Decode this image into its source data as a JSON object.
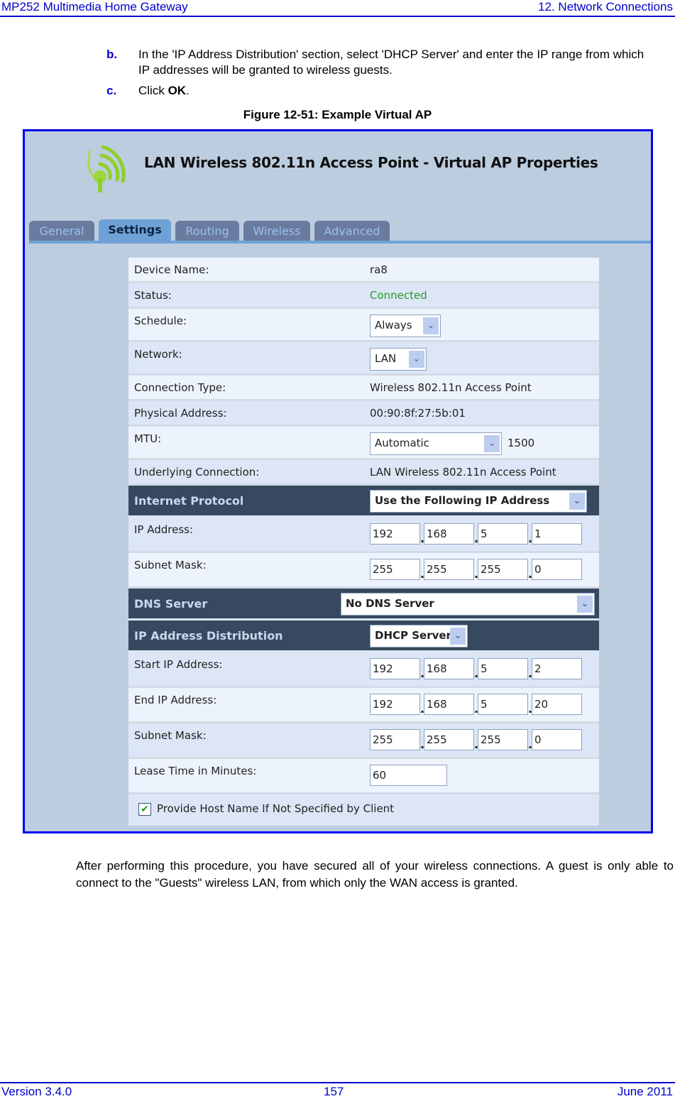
{
  "header": {
    "left": "MP252 Multimedia Home Gateway",
    "right": "12. Network Connections"
  },
  "steps": [
    {
      "letter": "b.",
      "text": "In the 'IP Address Distribution' section, select 'DHCP Server' and enter the IP range from which IP addresses will be granted to wireless guests."
    },
    {
      "letter": "c.",
      "text_before": "Click ",
      "bold": "OK",
      "text_after": "."
    }
  ],
  "figure": {
    "caption": "Figure 12-51: Example Virtual AP",
    "screen": {
      "title": "LAN Wireless 802.11n Access Point - Virtual AP Properties",
      "logo_icon": "wireless-signal-icon",
      "tabs": [
        {
          "label": "General",
          "active": false
        },
        {
          "label": "Settings",
          "active": true
        },
        {
          "label": "Routing",
          "active": false
        },
        {
          "label": "Wireless",
          "active": false
        },
        {
          "label": "Advanced",
          "active": false
        }
      ],
      "fields": {
        "device_name": {
          "label": "Device Name:",
          "value": "ra8"
        },
        "status": {
          "label": "Status:",
          "value": "Connected",
          "color": "#2a9a2a"
        },
        "schedule": {
          "label": "Schedule:",
          "selected": "Always"
        },
        "network": {
          "label": "Network:",
          "selected": "LAN"
        },
        "connection_type": {
          "label": "Connection Type:",
          "value": "Wireless 802.11n Access Point"
        },
        "physical_address": {
          "label": "Physical Address:",
          "value": "00:90:8f:27:5b:01"
        },
        "mtu": {
          "label": "MTU:",
          "selected": "Automatic",
          "value": "1500"
        },
        "underlying_connection": {
          "label": "Underlying Connection:",
          "value": "LAN Wireless 802.11n Access Point"
        }
      },
      "internet_protocol": {
        "label": "Internet Protocol",
        "selected": "Use the Following IP Address",
        "ip_address": {
          "label": "IP Address:",
          "octets": [
            "192",
            "168",
            "5",
            "1"
          ]
        },
        "subnet_mask": {
          "label": "Subnet Mask:",
          "octets": [
            "255",
            "255",
            "255",
            "0"
          ]
        }
      },
      "dns_server": {
        "label": "DNS Server",
        "selected": "No DNS Server"
      },
      "ip_distribution": {
        "label": "IP Address Distribution",
        "selected": "DHCP Server",
        "start_ip": {
          "label": "Start IP Address:",
          "octets": [
            "192",
            "168",
            "5",
            "2"
          ]
        },
        "end_ip": {
          "label": "End IP Address:",
          "octets": [
            "192",
            "168",
            "5",
            "20"
          ]
        },
        "subnet_mask": {
          "label": "Subnet Mask:",
          "octets": [
            "255",
            "255",
            "255",
            "0"
          ]
        },
        "lease_time": {
          "label": "Lease Time in Minutes:",
          "value": "60"
        },
        "provide_host_name": {
          "label": "Provide Host Name If Not Specified by Client",
          "checked": true
        }
      }
    }
  },
  "paragraph": "After performing this procedure, you have secured all of your wireless connections. A guest is only able to connect to the \"Guests\" wireless LAN, from which only the WAN access is granted.",
  "footer": {
    "left": "Version 3.4.0",
    "center": "157",
    "right": "June 2011"
  },
  "colors": {
    "header_blue": "#0000cc",
    "frame_blue": "#0000ee",
    "section_header": "#37495e",
    "tab_active": "#6ea2d6"
  }
}
